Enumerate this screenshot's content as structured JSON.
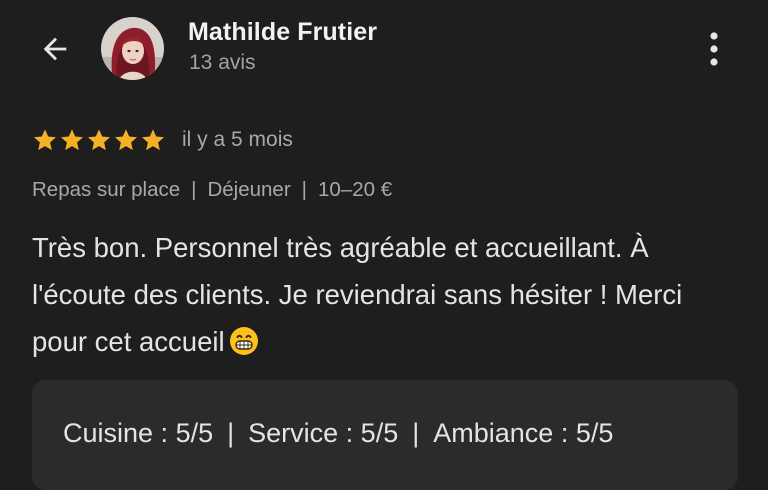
{
  "header": {
    "author_name": "Mathilde Frutier",
    "review_count": "13 avis",
    "back_icon": "arrow-left-icon",
    "more_icon": "more-vertical-icon"
  },
  "review": {
    "rating": 5,
    "rating_max": 5,
    "time_ago": "il y a 5 mois",
    "meta": [
      "Repas sur place",
      "Déjeuner",
      "10–20 €"
    ],
    "meta_separator": "|",
    "text": "Très bon. Personnel très agréable et accueillant. À l'écoute des clients. Je reviendrai sans hésiter ! Merci pour cet accueil",
    "emoji_icon": "grinning-face-icon"
  },
  "sub_ratings": [
    {
      "label": "Cuisine",
      "value": "5/5"
    },
    {
      "label": "Service",
      "value": "5/5"
    },
    {
      "label": "Ambiance",
      "value": "5/5"
    }
  ],
  "colors": {
    "background": "#1e1e1e",
    "star": "#f6b026",
    "muted_text": "#a8a8a8",
    "card": "#2b2b2d"
  }
}
